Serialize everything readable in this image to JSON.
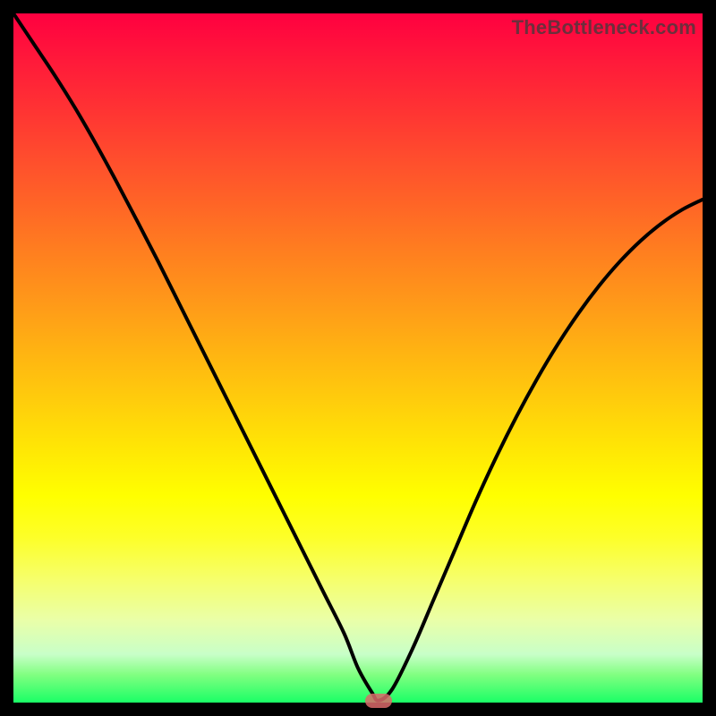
{
  "watermark": "TheBottleneck.com",
  "colors": {
    "curve": "#000000",
    "marker": "#d96a6a",
    "frame": "#000000"
  },
  "chart_data": {
    "type": "line",
    "title": "",
    "xlabel": "",
    "ylabel": "",
    "xlim": [
      0,
      100
    ],
    "ylim": [
      0,
      100
    ],
    "x": [
      0,
      3,
      6,
      9,
      12,
      15,
      18,
      21,
      24,
      27,
      30,
      33,
      36,
      39,
      42,
      45,
      48,
      50,
      52,
      53,
      55,
      58,
      61,
      64,
      67,
      70,
      73,
      76,
      79,
      82,
      85,
      88,
      91,
      94,
      97,
      100
    ],
    "values": [
      100,
      95.5,
      91,
      86.2,
      81,
      75.5,
      69.8,
      64,
      58,
      52,
      46,
      40,
      34,
      28,
      22,
      16,
      10,
      5,
      1.5,
      0.3,
      2,
      8,
      15,
      22,
      29,
      35.5,
      41.5,
      47,
      52,
      56.5,
      60.5,
      64,
      67,
      69.5,
      71.5,
      73
    ],
    "marker": {
      "x": 53,
      "y": 0.3
    },
    "annotations": [
      "TheBottleneck.com"
    ]
  }
}
